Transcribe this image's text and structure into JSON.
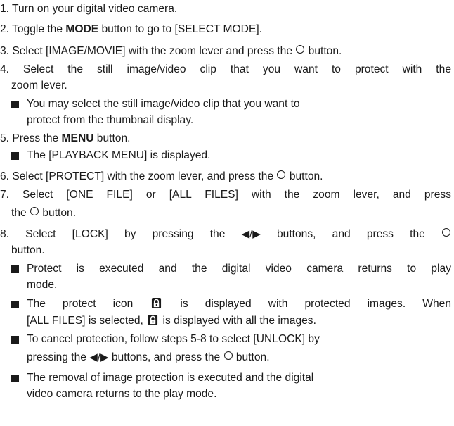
{
  "steps": {
    "s1": "1. Turn on your digital video camera.",
    "s2_a": "2. Toggle the ",
    "s2_b": "MODE",
    "s2_c": " button  to go to [SELECT MODE].",
    "s3_a": "3. Select [IMAGE/MOVIE] with the zoom lever and press the ",
    "s3_b": " button.",
    "s4_l1": "4. Select the still image/video clip that you want to protect with the",
    "s4_l2": "zoom lever.",
    "s4_bullet_l1": "You may select the still image/video clip that you want to",
    "s4_bullet_l2": "protect from the thumbnail display.",
    "s5_a": "5. Press the ",
    "s5_b": "MENU",
    "s5_c": " button.",
    "s5_bullet": "The [PLAYBACK MENU] is displayed.",
    "s6_a": "6. Select [PROTECT] with the zoom lever, and press the ",
    "s6_b": " button.",
    "s7_l1": "7. Select [ONE FILE] or [ALL FILES] with the zoom lever, and press",
    "s7_l2_a": "the ",
    "s7_l2_b": " button.",
    "s8_a": "8. Select [LOCK] by pressing the ",
    "s8_b": " buttons, and press the ",
    "s8_l2": "button.",
    "b1_l1": "Protect is executed and the digital video camera returns to play",
    "b1_l2": "mode.",
    "b2_l1_a": "The protect icon ",
    "b2_l1_b": " is displayed with protected images. When",
    "b2_l2_a": "[ALL FILES] is selected, ",
    "b2_l2_b": " is displayed with all the images.",
    "b3_l1": "To cancel protection, follow steps 5-8 to select [UNLOCK] by",
    "b3_l2_a": "pressing the ",
    "b3_l2_b": " buttons, and press the ",
    "b3_l2_c": " button.",
    "b4_l1": "The removal of image protection is executed and the digital",
    "b4_l2": "video camera returns to the play mode."
  },
  "icons": {
    "circle": "circle-button-icon",
    "arrows": "◀/▶",
    "lock": "protect-lock-icon"
  }
}
